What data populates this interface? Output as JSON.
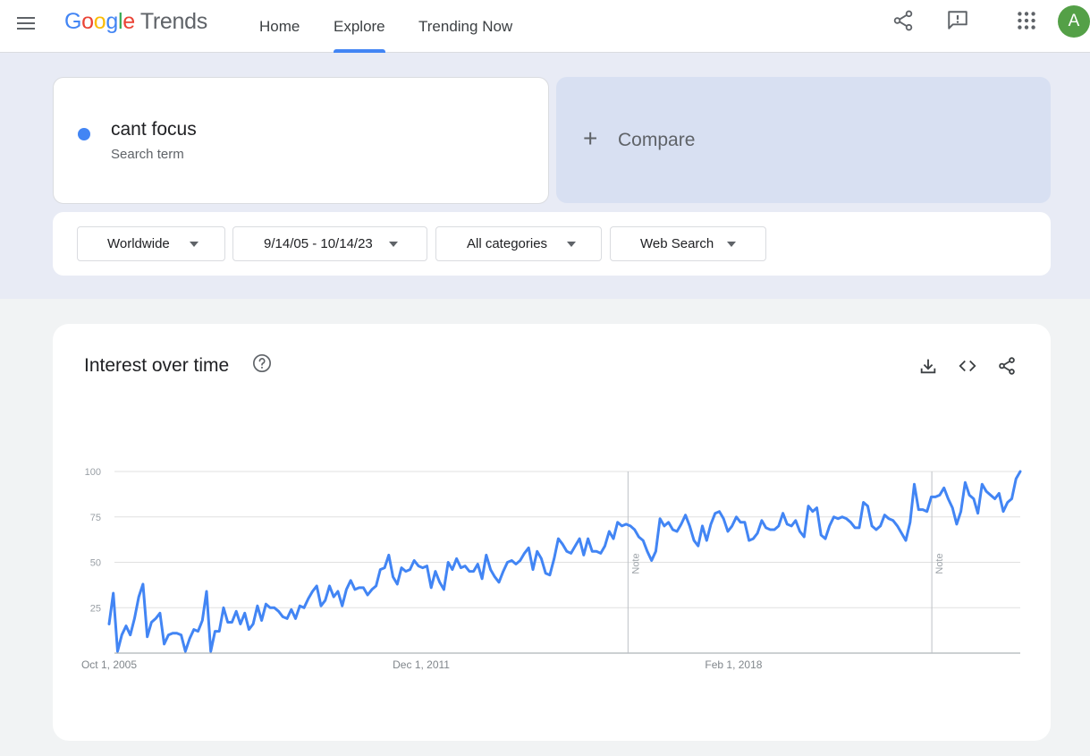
{
  "header": {
    "logo_google": "Google",
    "logo_trends": "Trends",
    "nav": [
      {
        "label": "Home",
        "active": false
      },
      {
        "label": "Explore",
        "active": true
      },
      {
        "label": "Trending Now",
        "active": false
      }
    ],
    "avatar_letter": "A",
    "icons": [
      "menu-icon",
      "share-icon",
      "feedback-icon",
      "apps-grid-icon"
    ]
  },
  "search": {
    "term": "cant focus",
    "term_type": "Search term",
    "term_color": "#4285f4",
    "compare_label": "Compare"
  },
  "filters": {
    "region": "Worldwide",
    "date_range": "9/14/05 - 10/14/23",
    "category": "All categories",
    "property": "Web Search"
  },
  "card": {
    "title": "Interest over time",
    "icons": [
      "help-icon",
      "download-icon",
      "embed-icon",
      "share-icon"
    ]
  },
  "chart_data": {
    "type": "line",
    "title": "Interest over time",
    "xlabel": "",
    "ylabel": "",
    "ylim": [
      0,
      100
    ],
    "yticks": [
      "100",
      "75",
      "50",
      "25"
    ],
    "xticks": [
      {
        "label": "Oct 1, 2005",
        "date": "2005-10-01"
      },
      {
        "label": "Dec 1, 2011",
        "date": "2011-12-01"
      },
      {
        "label": "Feb 1, 2018",
        "date": "2018-02-01"
      }
    ],
    "x_range": [
      "2005-10-01",
      "2023-10-01"
    ],
    "grid": true,
    "line_color": "#4285f4",
    "notes": [
      {
        "label": "Note",
        "date": "2016-01-01"
      },
      {
        "label": "Note",
        "date": "2022-01-01"
      }
    ],
    "series": [
      {
        "name": "cant focus",
        "values": [
          16,
          33,
          1,
          10,
          15,
          10,
          19,
          31,
          38,
          9,
          17,
          19,
          22,
          5,
          10,
          11,
          11,
          10,
          1,
          8,
          13,
          12,
          18,
          34,
          1,
          12,
          12,
          25,
          17,
          17,
          23,
          16,
          22,
          13,
          16,
          26,
          18,
          27,
          25,
          25,
          23,
          20,
          19,
          24,
          19,
          26,
          25,
          30,
          34,
          37,
          26,
          29,
          37,
          31,
          34,
          26,
          35,
          40,
          35,
          36,
          36,
          32,
          35,
          37,
          46,
          47,
          54,
          42,
          38,
          47,
          45,
          46,
          51,
          48,
          47,
          48,
          36,
          45,
          39,
          35,
          50,
          46,
          52,
          47,
          48,
          45,
          45,
          49,
          41,
          54,
          46,
          42,
          39,
          45,
          50,
          51,
          49,
          51,
          55,
          58,
          46,
          56,
          52,
          44,
          43,
          52,
          63,
          60,
          56,
          55,
          59,
          63,
          54,
          63,
          56,
          56,
          55,
          59,
          67,
          63,
          72,
          70,
          71,
          70,
          68,
          64,
          62,
          56,
          51,
          56,
          74,
          70,
          72,
          68,
          67,
          71,
          76,
          70,
          62,
          59,
          70,
          62,
          71,
          77,
          78,
          74,
          67,
          70,
          75,
          72,
          72,
          62,
          63,
          66,
          73,
          69,
          68,
          68,
          70,
          77,
          71,
          70,
          73,
          67,
          64,
          81,
          78,
          80,
          65,
          63,
          70,
          75,
          74,
          75,
          74,
          72,
          69,
          69,
          83,
          81,
          70,
          68,
          70,
          76,
          74,
          73,
          70,
          66,
          62,
          72,
          93,
          79,
          79,
          78,
          86,
          86,
          87,
          91,
          85,
          80,
          71,
          78,
          94,
          87,
          85,
          77,
          93,
          89,
          87,
          85,
          88,
          78,
          83,
          85,
          96,
          100
        ]
      }
    ]
  }
}
